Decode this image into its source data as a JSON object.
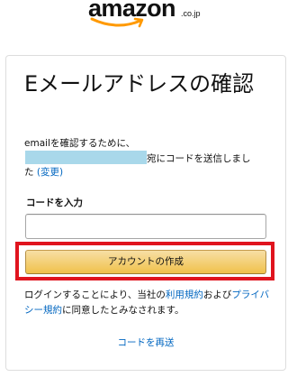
{
  "logo": {
    "wordmark": "amazon",
    "suffix": ".co.jp",
    "smile_color": "#f90"
  },
  "page": {
    "title": "Eメールアドレスの確認"
  },
  "description": {
    "line1": "emailを確認するために、",
    "line2_after_redaction": "宛にコードを送信しまし",
    "line3_prefix": "た",
    "change_link": "(変更)"
  },
  "form": {
    "code_label": "コードを入力",
    "code_value": "",
    "create_button_label": "アカウントの作成"
  },
  "legal": {
    "text1": "ログインすることにより、当社の",
    "terms_link": "利用規約",
    "text2": "および",
    "privacy_link": "プライバシー規約",
    "text3": "に同意したとみなされます。"
  },
  "resend_link": "コードを再送",
  "colors": {
    "link": "#0066c0",
    "button_top": "#f7dfa5",
    "button_bottom": "#f0c14b",
    "highlight": "#e0141e",
    "redaction": "#a9d8ea"
  }
}
